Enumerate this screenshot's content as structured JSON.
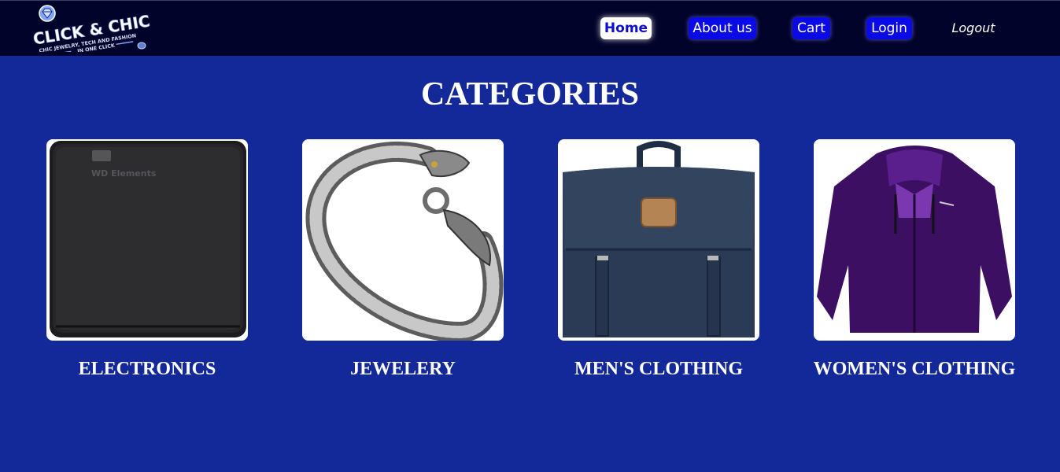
{
  "header": {
    "logo": {
      "title": "CLICK & CHIC",
      "tagline_line1": "CHIC JEWELRY, TECH AND FASHION",
      "tagline_line2": "IN ONE CLICK"
    },
    "nav": {
      "home": "Home",
      "about": "About us",
      "cart": "Cart",
      "login": "Login",
      "logout": "Logout"
    }
  },
  "main": {
    "title": "CATEGORIES",
    "categories": [
      {
        "label": "ELECTRONICS",
        "icon": "external-hard-drive"
      },
      {
        "label": "JEWELERY",
        "icon": "dragon-bracelet"
      },
      {
        "label": "MEN'S CLOTHING",
        "icon": "navy-backpack"
      },
      {
        "label": "WOMEN'S CLOTHING",
        "icon": "purple-jacket"
      }
    ],
    "product_text": {
      "hdd_brand": "WD Elements"
    }
  },
  "colors": {
    "background": "#142999",
    "navbar": "#02032a",
    "nav_button": "#0a0ae6",
    "active_nav": "#ffffff"
  }
}
